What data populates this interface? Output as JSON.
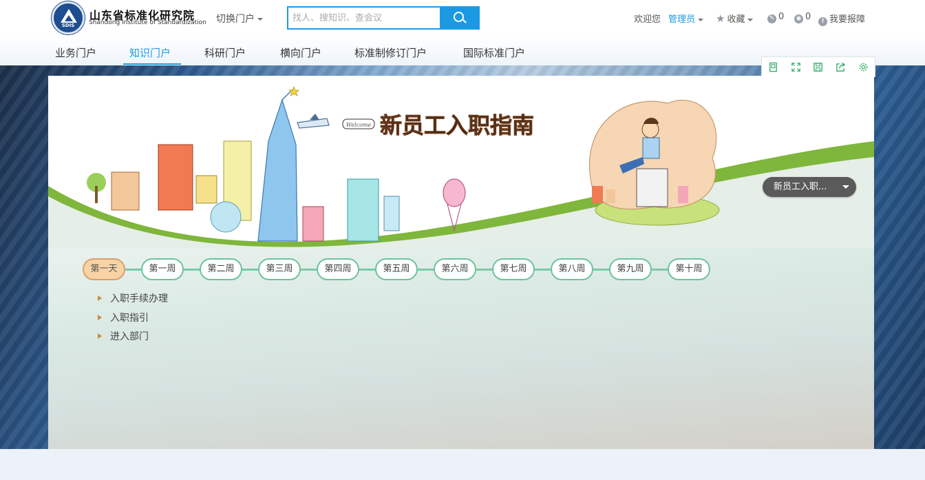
{
  "header": {
    "logo_abbr": "SDIS",
    "org_name_cn": "山东省标准化研究院",
    "org_name_en": "Shandong Institute of Standardization",
    "portal_switch": "切换门户",
    "search_placeholder": "找人、搜知识、查会议",
    "welcome": "欢迎您",
    "user": "管理员",
    "favorites": "收藏",
    "count_a": "0",
    "count_b": "0",
    "report": "我要报障"
  },
  "nav": {
    "items": [
      "业务门户",
      "知识门户",
      "科研门户",
      "横向门户",
      "标准制修订门户",
      "国际标准门户"
    ],
    "active": "知识门户"
  },
  "toolbar": {
    "icons": [
      "page-icon",
      "fullscreen-icon",
      "save-icon",
      "share-icon",
      "settings-icon"
    ]
  },
  "banner": {
    "title": "新员工入职指南",
    "welcome_sign": "Welcome"
  },
  "dropdown": {
    "selected": "新员工入职..."
  },
  "timeline": {
    "weeks": [
      "第一天",
      "第一周",
      "第二周",
      "第三周",
      "第四周",
      "第五周",
      "第六周",
      "第七周",
      "第八周",
      "第九周",
      "第十周"
    ],
    "active": "第一天"
  },
  "tasks": [
    "入职手续办理",
    "入职指引",
    "进入部门"
  ],
  "colors": {
    "accent": "#1b9ae4",
    "timeline": "#6cc39c",
    "active_week": "#f8d3a5",
    "dropdown": "#5a5a5a",
    "bullet": "#c68a3f"
  }
}
